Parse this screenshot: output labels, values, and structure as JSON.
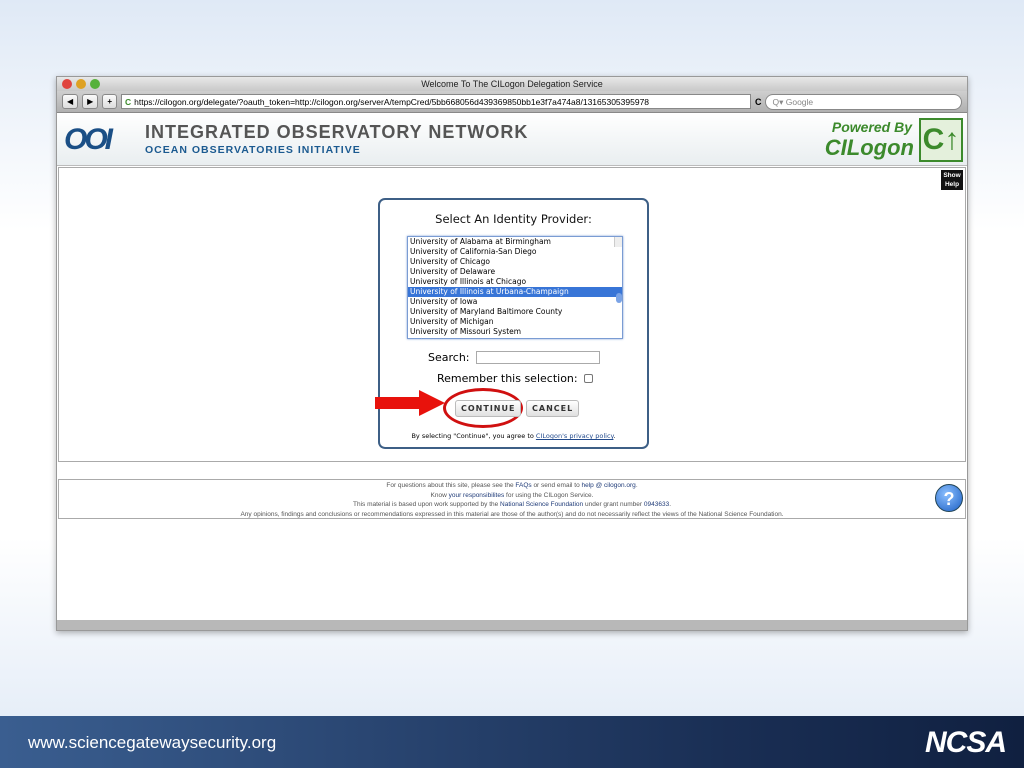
{
  "browser": {
    "title": "Welcome To The CILogon Delegation Service",
    "url": "https://cilogon.org/delegate/?oauth_token=http://cilogon.org/serverA/tempCred/5bb668056d439369850bb1e3f7a474a8/13165305395978",
    "search_placeholder": "Google",
    "back": "◀",
    "forward": "▶",
    "add": "+",
    "reload": "C"
  },
  "header": {
    "logo": "OOI",
    "title": "INTEGRATED OBSERVATORY NETWORK",
    "subtitle": "OCEAN OBSERVATORIES INITIATIVE",
    "powered_by": "Powered By",
    "cilogon": "CILogon"
  },
  "show_help": "Show Help",
  "panel": {
    "title": "Select An Identity Provider:",
    "providers": [
      "University of Alabama at Birmingham",
      "University of California-San Diego",
      "University of Chicago",
      "University of Delaware",
      "University of Illinois at Chicago",
      "University of Illinois at Urbana-Champaign",
      "University of Iowa",
      "University of Maryland Baltimore County",
      "University of Michigan",
      "University of Missouri System"
    ],
    "selected": "University of Illinois at Urbana-Champaign",
    "search_label": "Search:",
    "search_value": "",
    "remember_label": "Remember this selection:",
    "remember_checked": false,
    "continue": "CONTINUE",
    "cancel": "CANCEL",
    "agree_prefix": "By selecting \"Continue\", you agree to ",
    "privacy_link": "CILogon's privacy policy",
    "agree_suffix": "."
  },
  "footer": {
    "l1a": "For questions about this site, please see the ",
    "faqs": "FAQs",
    "l1b": " or send email to ",
    "email": "help @ cilogon.org",
    "l1c": ".",
    "l2a": "Know ",
    "resp": "your responsibilites",
    "l2b": " for using the CILogon Service.",
    "l3a": "This material is based upon work supported by the ",
    "nsf": "National Science Foundation",
    "l3b": " under grant number ",
    "grant": "0943633",
    "l3c": ".",
    "l4": "Any opinions, findings and conclusions or recommendations expressed in this material are those of the author(s) and do not necessarily reflect the views of the National Science Foundation.",
    "help_icon": "?"
  },
  "slide": {
    "url": "www.sciencegatewaysecurity.org",
    "logo": "NCSA"
  }
}
